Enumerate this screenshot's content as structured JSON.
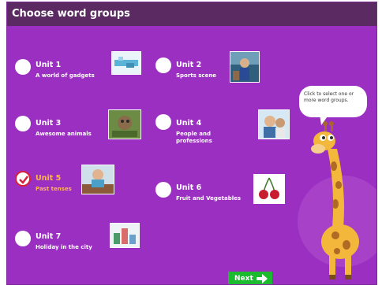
{
  "title": "Choose word groups",
  "units": [
    {
      "name": "Unit 1",
      "desc": "A world of gadgets",
      "selected": false,
      "thumb": "gadgets-image"
    },
    {
      "name": "Unit 2",
      "desc": "Sports scene",
      "selected": false,
      "thumb": "sports-image"
    },
    {
      "name": "Unit 3",
      "desc": "Awesome animals",
      "selected": false,
      "thumb": "animals-image"
    },
    {
      "name": "Unit 4",
      "desc": "People and professions",
      "selected": false,
      "thumb": "people-image"
    },
    {
      "name": "Unit 5",
      "desc": "Past tenses",
      "selected": true,
      "thumb": "past-image"
    },
    {
      "name": "Unit 6",
      "desc": "Fruit and Vegetables",
      "selected": false,
      "thumb": "cherries-image"
    },
    {
      "name": "Unit 7",
      "desc": "Holiday in the city",
      "selected": false,
      "thumb": "holiday-image"
    }
  ],
  "bubble_text": "Click to select one or more word groups.",
  "next_label": "Next",
  "colors": {
    "background": "#9b2fc2",
    "titlebar": "#5b2a63",
    "selected": "#d8203a",
    "selected_text": "#ffb64a",
    "next_button": "#1cba2f"
  }
}
